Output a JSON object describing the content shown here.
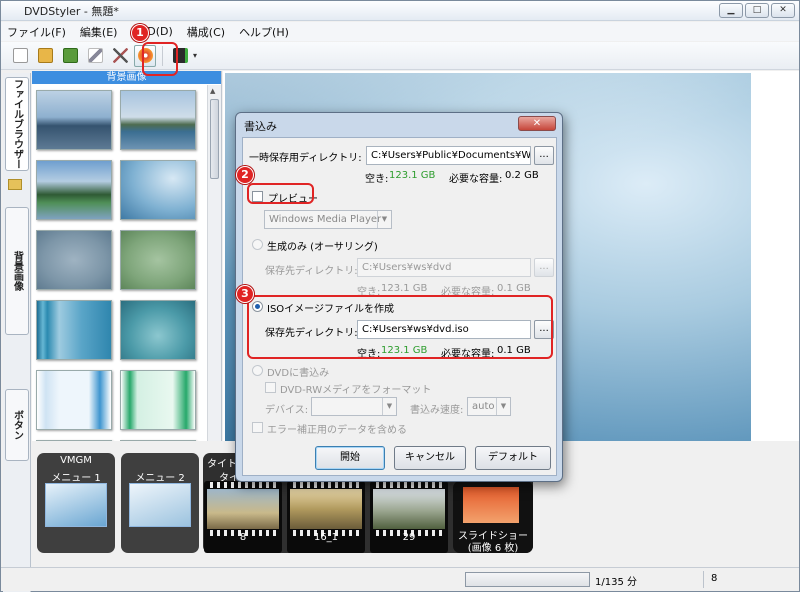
{
  "window": {
    "title": "DVDStyler - 無題*",
    "minimize": "▁",
    "maximize": "□",
    "close": "✕"
  },
  "menu": [
    "ファイル(F)",
    "編集(E)",
    "DVD(D)",
    "構成(C)",
    "ヘルプ(H)"
  ],
  "toolbar": {
    "icons": [
      "new-icon",
      "open-icon",
      "save-icon",
      "wand-icon",
      "tools-icon",
      "burn-icon",
      "add-file-icon"
    ],
    "dropdown": "▾"
  },
  "sidebar": {
    "tabs": [
      "ファイルブラウザー",
      "背景画像",
      "ボタン"
    ]
  },
  "browser": {
    "header": "背景画像"
  },
  "titleset": {
    "vmgm": "VMGM",
    "menus": [
      "メニュー 1",
      "メニュー 2"
    ],
    "titles_label": "タイトル",
    "title_tab": "タイ",
    "clips": [
      "8",
      "16_1",
      "29"
    ],
    "slideshow": "スライドショー",
    "slideshow_count": "(画像 6 枚)"
  },
  "status": {
    "duration": "1/135 分",
    "count": "8"
  },
  "dialog": {
    "title": "書込み",
    "close": "✕",
    "temp_dir_label": "一時保存用ディレクトリ:",
    "temp_dir_value": "C:¥Users¥Public¥Documents¥Wond",
    "browse": "...",
    "free_label": "空き:",
    "free_value": "123.1 GB",
    "required_label": "必要な容量:",
    "temp_required": "0.2 GB",
    "preview_label": "プレビュー",
    "preview_player": "Windows Media Player",
    "authoring_label": "生成のみ (オーサリング)",
    "save_dir_label": "保存先ディレクトリ:",
    "authoring_dir": "C:¥Users¥ws¥dvd",
    "authoring_free": "123.1 GB",
    "authoring_required": "0.1 GB",
    "iso_label": "ISOイメージファイルを作成",
    "iso_dir": "C:¥Users¥ws¥dvd.iso",
    "iso_free": "123.1 GB",
    "iso_required": "0.1 GB",
    "dvd_label": "DVDに書込み",
    "format_label": "DVD-RWメディアをフォーマット",
    "device_label": "デバイス:",
    "speed_label": "書込み速度:",
    "speed_value": "auto",
    "ecc_label": "エラー補正用のデータを含める",
    "start_button": "開始",
    "cancel_button": "キャンセル",
    "default_button": "デフォルト"
  },
  "annotations": [
    "1",
    "2",
    "3"
  ],
  "colors": {
    "accent": "#3d8ee0",
    "annotation": "#e02424",
    "free_space": "#2e9d2e"
  }
}
